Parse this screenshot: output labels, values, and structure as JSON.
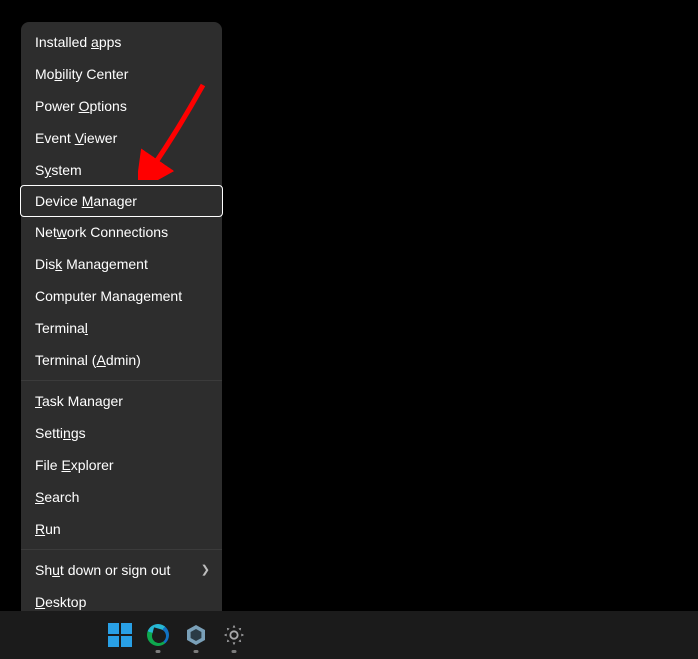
{
  "menu": {
    "groups": [
      [
        {
          "key": "installed-apps",
          "pre": "Installed ",
          "acc": "a",
          "post": "pps"
        },
        {
          "key": "mobility-center",
          "pre": "Mo",
          "acc": "b",
          "post": "ility Center"
        },
        {
          "key": "power-options",
          "pre": "Power ",
          "acc": "O",
          "post": "ptions"
        },
        {
          "key": "event-viewer",
          "pre": "Event ",
          "acc": "V",
          "post": "iewer"
        },
        {
          "key": "system",
          "pre": "S",
          "acc": "y",
          "post": "stem"
        },
        {
          "key": "device-manager",
          "pre": "Device ",
          "acc": "M",
          "post": "anager",
          "highlighted": true
        },
        {
          "key": "network-connections",
          "pre": "Net",
          "acc": "w",
          "post": "ork Connections"
        },
        {
          "key": "disk-management",
          "pre": "Dis",
          "acc": "k",
          "post": " Management"
        },
        {
          "key": "computer-management",
          "pre": "Computer Mana",
          "acc": "g",
          "post": "ement"
        },
        {
          "key": "terminal",
          "pre": "Termina",
          "acc": "l",
          "post": ""
        },
        {
          "key": "terminal-admin",
          "pre": "Terminal (",
          "acc": "A",
          "post": "dmin)"
        }
      ],
      [
        {
          "key": "task-manager",
          "pre": "",
          "acc": "T",
          "post": "ask Manager"
        },
        {
          "key": "settings",
          "pre": "Setti",
          "acc": "n",
          "post": "gs"
        },
        {
          "key": "file-explorer",
          "pre": "File ",
          "acc": "E",
          "post": "xplorer"
        },
        {
          "key": "search",
          "pre": "",
          "acc": "S",
          "post": "earch"
        },
        {
          "key": "run",
          "pre": "",
          "acc": "R",
          "post": "un"
        }
      ],
      [
        {
          "key": "shut-down",
          "pre": "Sh",
          "acc": "u",
          "post": "t down or sign out",
          "submenu": true
        },
        {
          "key": "desktop",
          "pre": "",
          "acc": "D",
          "post": "esktop"
        }
      ]
    ]
  },
  "annotation": {
    "type": "arrow",
    "color": "#ff0000"
  },
  "taskbar": {
    "items": [
      {
        "key": "start",
        "name": "windows-start-icon",
        "active": false
      },
      {
        "key": "edge",
        "name": "edge-icon",
        "active": true
      },
      {
        "key": "epic",
        "name": "epic-icon",
        "active": true
      },
      {
        "key": "settings",
        "name": "settings-gear-icon",
        "active": true
      }
    ]
  }
}
